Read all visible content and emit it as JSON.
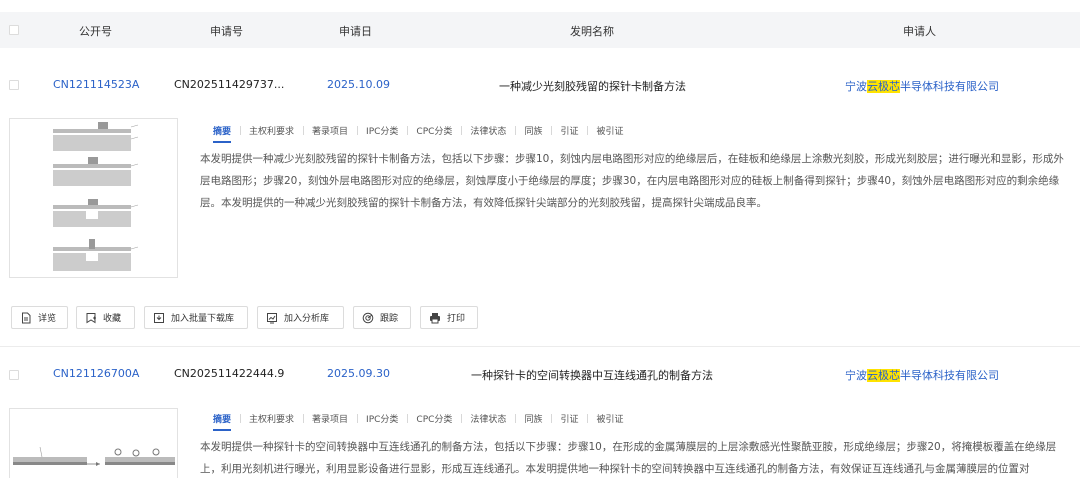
{
  "header": {
    "col_pub": "公开号",
    "col_app": "申请号",
    "col_date": "申请日",
    "col_title": "发明名称",
    "col_applicant": "申请人"
  },
  "tabs": [
    "摘要",
    "主权利要求",
    "著录项目",
    "IPC分类",
    "CPC分类",
    "法律状态",
    "同族",
    "引证",
    "被引证"
  ],
  "records": [
    {
      "pub_no": "CN121114523A",
      "app_no": "CN202511429737...",
      "app_date": "2025.10.09",
      "title": "一种减少光刻胶残留的探针卡制备方法",
      "applicant_pre": "宁波",
      "applicant_hl": "云极芯",
      "applicant_post": "半导体科技有限公司",
      "abstract": "本发明提供一种减少光刻胶残留的探针卡制备方法，包括以下步骤：步骤10，刻蚀内层电路图形对应的绝缘层后，在硅板和绝缘层上涂敷光刻胶，形成光刻胶层；进行曝光和显影，形成外层电路图形；步骤20，刻蚀外层电路图形对应的绝缘层，刻蚀厚度小于绝缘层的厚度；步骤30，在内层电路图形对应的硅板上制备得到探针；步骤40，刻蚀外层电路图形对应的剩余绝缘层。本发明提供的一种减少光刻胶残留的探针卡制备方法，有效降低探针尖端部分的光刻胶残留，提高探针尖端成品良率。"
    },
    {
      "pub_no": "CN121126700A",
      "app_no": "CN202511422444.9",
      "app_date": "2025.09.30",
      "title": "一种探针卡的空间转换器中互连线通孔的制备方法",
      "applicant_pre": "宁波",
      "applicant_hl": "云极芯",
      "applicant_post": "半导体科技有限公司",
      "abstract": "本发明提供一种探针卡的空间转换器中互连线通孔的制备方法，包括以下步骤：步骤10，在形成的金属薄膜层的上层涂敷感光性聚酰亚胺，形成绝缘层；步骤20，将掩模板覆盖在绝缘层上，利用光刻机进行曝光，利用显影设备进行显影，形成互连线通孔。本发明提供地一种探针卡的空间转换器中互连线通孔的制备方法，有效保证互连线通孔与金属薄膜层的位置对"
    }
  ],
  "actions": {
    "detail": "详览",
    "favorite": "收藏",
    "batch_download": "加入批量下载库",
    "analysis": "加入分析库",
    "track": "跟踪",
    "print": "打印"
  },
  "colors": {
    "link": "#2b62c8",
    "highlight": "#ffe300",
    "header_bg": "#f4f5f7"
  }
}
